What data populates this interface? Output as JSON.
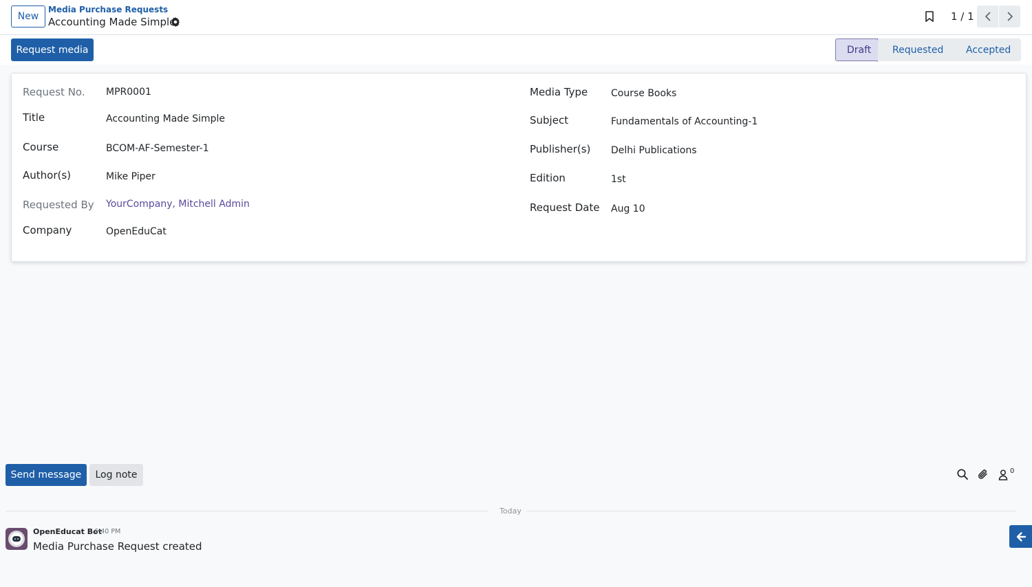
{
  "header": {
    "new_label": "New",
    "breadcrumb": "Media Purchase Requests",
    "record_title": "Accounting Made Simple",
    "pager": "1 / 1"
  },
  "actions": {
    "request_media_label": "Request media"
  },
  "statusbar": {
    "stages": [
      "Draft",
      "Requested",
      "Accepted"
    ],
    "active": "Draft"
  },
  "form": {
    "left": [
      {
        "label": "Request No.",
        "value": "MPR0001"
      },
      {
        "label": "Title",
        "value": "Accounting Made Simple"
      },
      {
        "label": "Course",
        "value": "BCOM-AF-Semester-1"
      },
      {
        "label": "Author(s)",
        "value": "Mike Piper"
      },
      {
        "label": "Requested By",
        "value": "YourCompany, Mitchell Admin"
      },
      {
        "label": "Company",
        "value": "OpenEduCat"
      }
    ],
    "right": [
      {
        "label": "Media Type",
        "value": "Course Books"
      },
      {
        "label": "Subject",
        "value": "Fundamentals of Accounting-1"
      },
      {
        "label": "Publisher(s)",
        "value": "Delhi Publications"
      },
      {
        "label": "Edition",
        "value": "1st"
      },
      {
        "label": "Request Date",
        "value": "Aug 10"
      }
    ]
  },
  "chatter": {
    "send_message_label": "Send message",
    "log_note_label": "Log note",
    "followers_count": "0",
    "date_separator": "Today",
    "messages": [
      {
        "author": "OpenEducat Bot",
        "time": "6:40 PM",
        "body": "Media Purchase Request created"
      }
    ]
  },
  "colors": {
    "primary": "#1f5fa8",
    "active_stage": "#dcdcf0",
    "link": "#5b4a9b"
  }
}
